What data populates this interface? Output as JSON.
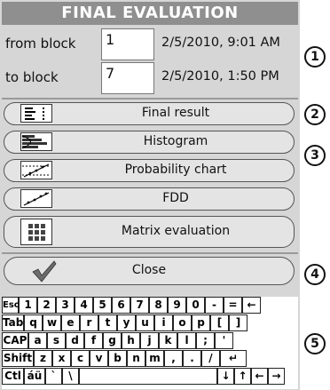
{
  "window": {
    "title": "FINAL EVALUATION"
  },
  "range": {
    "from": {
      "label": "from block",
      "value": "1",
      "datetime": "2/5/2010, 9:01 AM"
    },
    "to": {
      "label": "to block",
      "value": "7",
      "datetime": "2/5/2010, 1:50 PM"
    }
  },
  "options": [
    {
      "label": "Final result",
      "icon": "final-result-icon"
    },
    {
      "label": "Histogram",
      "icon": "histogram-icon"
    },
    {
      "label": "Probability chart",
      "icon": "probability-chart-icon"
    },
    {
      "label": "FDD",
      "icon": "fdd-icon"
    },
    {
      "label": "Matrix evaluation",
      "icon": "matrix-icon"
    }
  ],
  "close": {
    "label": "Close",
    "icon": "check-icon"
  },
  "keyboard": {
    "rows": [
      [
        "Esc",
        "1",
        "2",
        "3",
        "4",
        "5",
        "6",
        "7",
        "8",
        "9",
        "0",
        "-",
        "=",
        "←"
      ],
      [
        "Tab",
        "q",
        "w",
        "e",
        "r",
        "t",
        "y",
        "u",
        "i",
        "o",
        "p",
        "[",
        "]"
      ],
      [
        "CAP",
        "a",
        "s",
        "d",
        "f",
        "g",
        "h",
        "j",
        "k",
        "l",
        ";",
        "'"
      ],
      [
        "Shift",
        "z",
        "x",
        "c",
        "v",
        "b",
        "n",
        "m",
        ",",
        ".",
        "/",
        "↵"
      ],
      [
        "Ctl",
        "áü",
        "`",
        "\\",
        "",
        "↓",
        "↑",
        "←",
        "→"
      ]
    ]
  },
  "callouts": [
    "1",
    "2",
    "3",
    "4",
    "5"
  ]
}
